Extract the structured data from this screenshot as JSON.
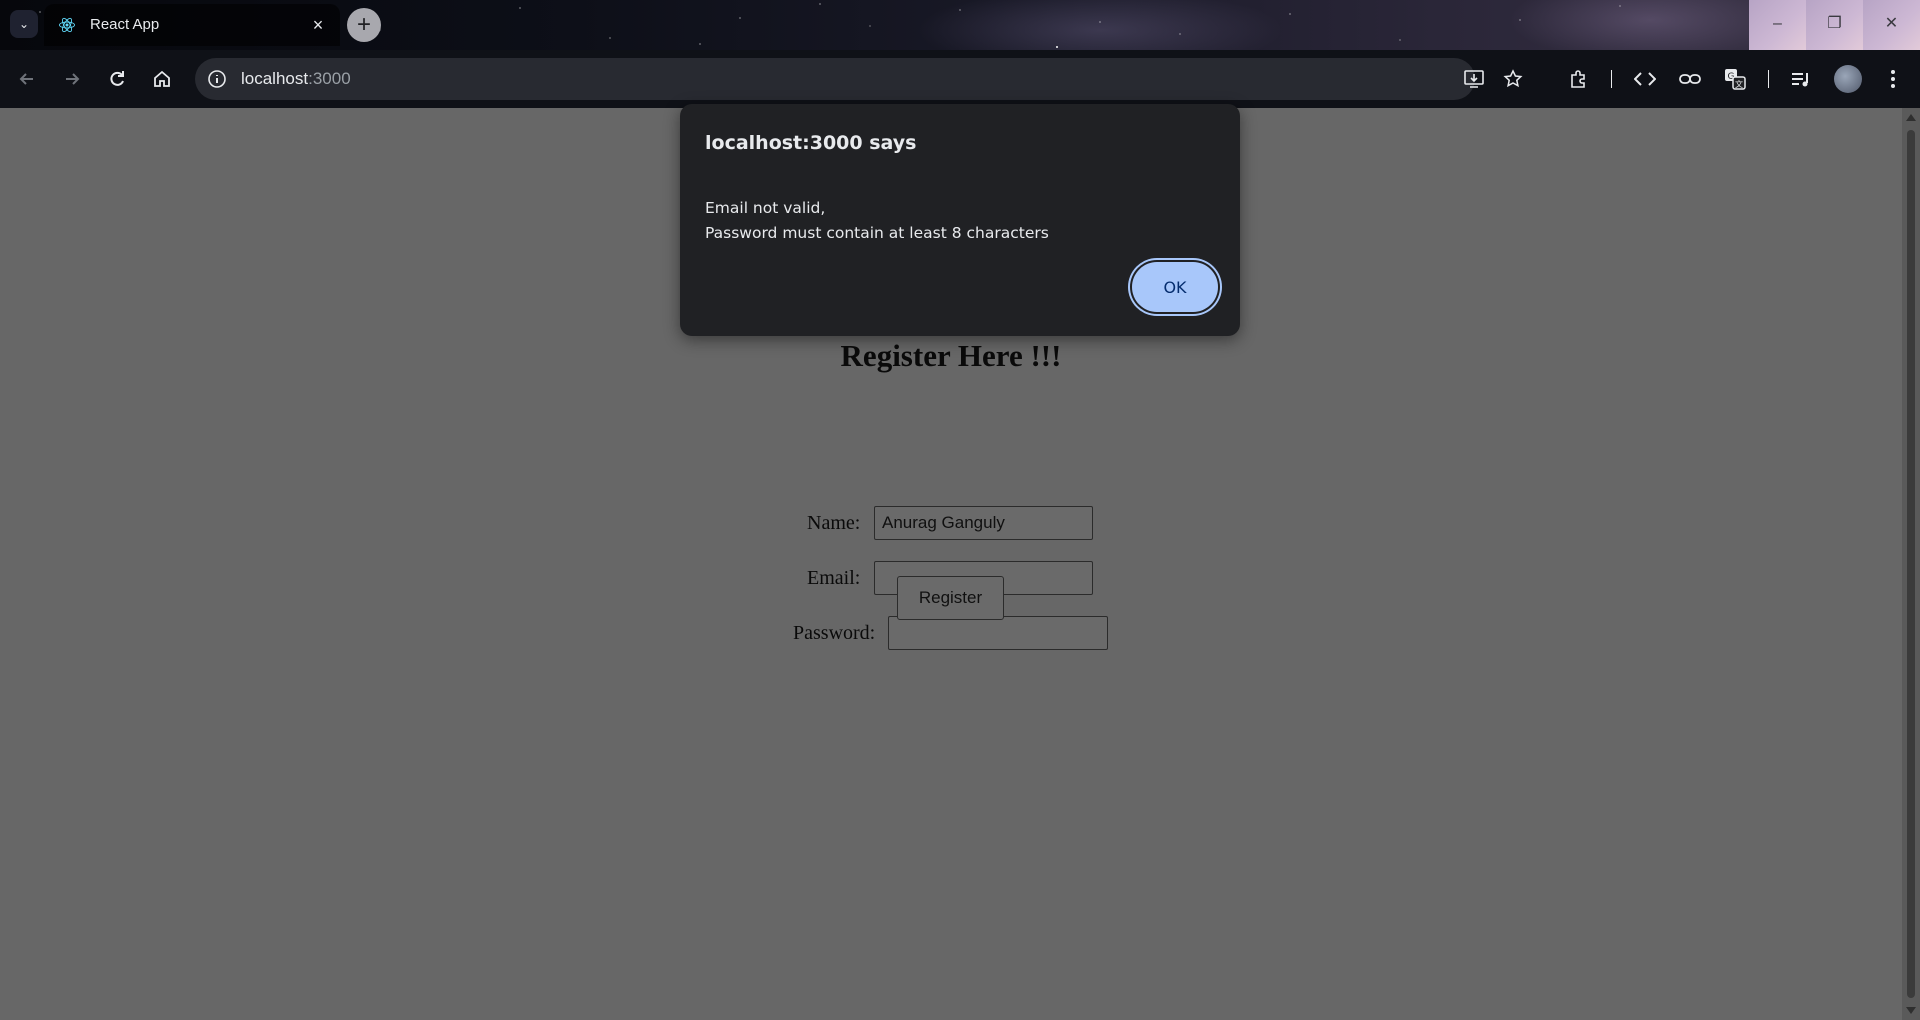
{
  "browser": {
    "tab_title": "React App",
    "tab_close": "×",
    "new_tab": "+",
    "url_host": "localhost",
    "url_port": ":3000"
  },
  "window_controls": {
    "minimize": "–",
    "restore": "❐",
    "close": "✕"
  },
  "form": {
    "title": "Register Here !!!",
    "name_label": "Name:",
    "name_value": "Anurag Ganguly",
    "email_label": "Email:",
    "email_value": "",
    "password_label": "Password:",
    "password_value": "",
    "register_label": "Register"
  },
  "dialog": {
    "title": "localhost:3000 says",
    "line1": "Email not valid,",
    "line2": "Password must contain at least 8 characters",
    "ok_label": "OK"
  },
  "colors": {
    "accent": "#a8c7fa",
    "page_bg": "#676767",
    "dialog_bg": "#202124"
  }
}
